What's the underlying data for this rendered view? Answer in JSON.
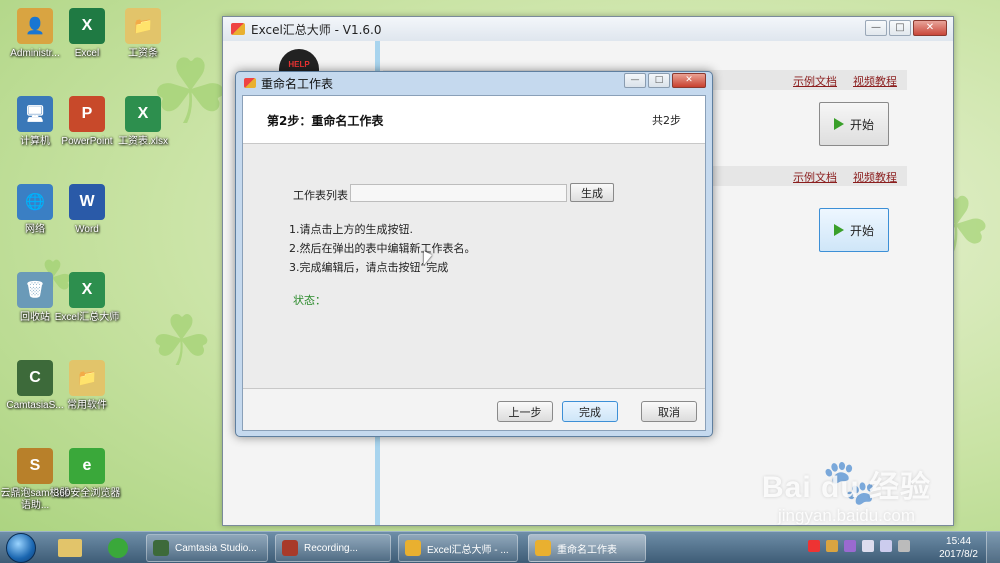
{
  "desktop": {
    "icons": [
      {
        "label": "Administr...",
        "color": "#d9a441",
        "glyph": "👤"
      },
      {
        "label": "Excel",
        "color": "#1f7a43",
        "glyph": "X"
      },
      {
        "label": "工资条",
        "color": "#e2c46a",
        "glyph": "📁"
      },
      {
        "label": "计算机",
        "color": "#3a78b8",
        "glyph": "🖥"
      },
      {
        "label": "PowerPoint",
        "color": "#c8492a",
        "glyph": "P"
      },
      {
        "label": "工资表.xlsx",
        "color": "#2d8f4e",
        "glyph": "X"
      },
      {
        "label": "网络",
        "color": "#3a7fc4",
        "glyph": "🌐"
      },
      {
        "label": "Word",
        "color": "#2a5aa8",
        "glyph": "W"
      },
      {
        "label": "回收站",
        "color": "#6a9ab8",
        "glyph": "🗑"
      },
      {
        "label": "Excel汇总大师",
        "color": "#2d8f4e",
        "glyph": "X"
      },
      {
        "label": "CamtasiaS...",
        "color": "#3d6a3a",
        "glyph": "C"
      },
      {
        "label": "常用软件",
        "color": "#e2c46a",
        "glyph": "📁"
      },
      {
        "label": "云鼎泡sam机器语助...",
        "color": "#b8802a",
        "glyph": "S"
      },
      {
        "label": "360安全浏览器",
        "color": "#3aa83a",
        "glyph": "e"
      }
    ]
  },
  "main_window": {
    "title": "Excel汇总大师 - V1.6.0",
    "robot_text": "HELP",
    "rows": [
      {
        "link1": "示例文档",
        "link2": "视频教程",
        "start": "开始"
      },
      {
        "link1": "示例文档",
        "link2": "视频教程",
        "start": "开始"
      }
    ]
  },
  "dialog": {
    "title": "重命名工作表",
    "step_title": "第2步：重命名工作表",
    "step_count": "共2步",
    "field_label": "工作表列表：",
    "field_value": "",
    "generate_label": "生成",
    "instructions": [
      "1.请点击上方的生成按钮.",
      "2.然后在弹出的表中编辑新工作表名。",
      "3.完成编辑后，请点击按钮“完成"
    ],
    "status_label": "状态：",
    "prev_label": "上一步",
    "finish_label": "完成",
    "cancel_label": "取消"
  },
  "taskbar": {
    "items": [
      {
        "label": "Camtasia Studio...",
        "color": "#3d6a3a"
      },
      {
        "label": "Recording...",
        "color": "#a83a2a"
      },
      {
        "label": "Excel汇总大师 - ...",
        "color": "#e9b030"
      },
      {
        "label": "重命名工作表",
        "color": "#e9b030"
      }
    ],
    "time": "15:44",
    "date": "2017/8/2"
  },
  "watermark": {
    "logo": "Bai du 经验",
    "url": "jingyan.baidu.com"
  }
}
